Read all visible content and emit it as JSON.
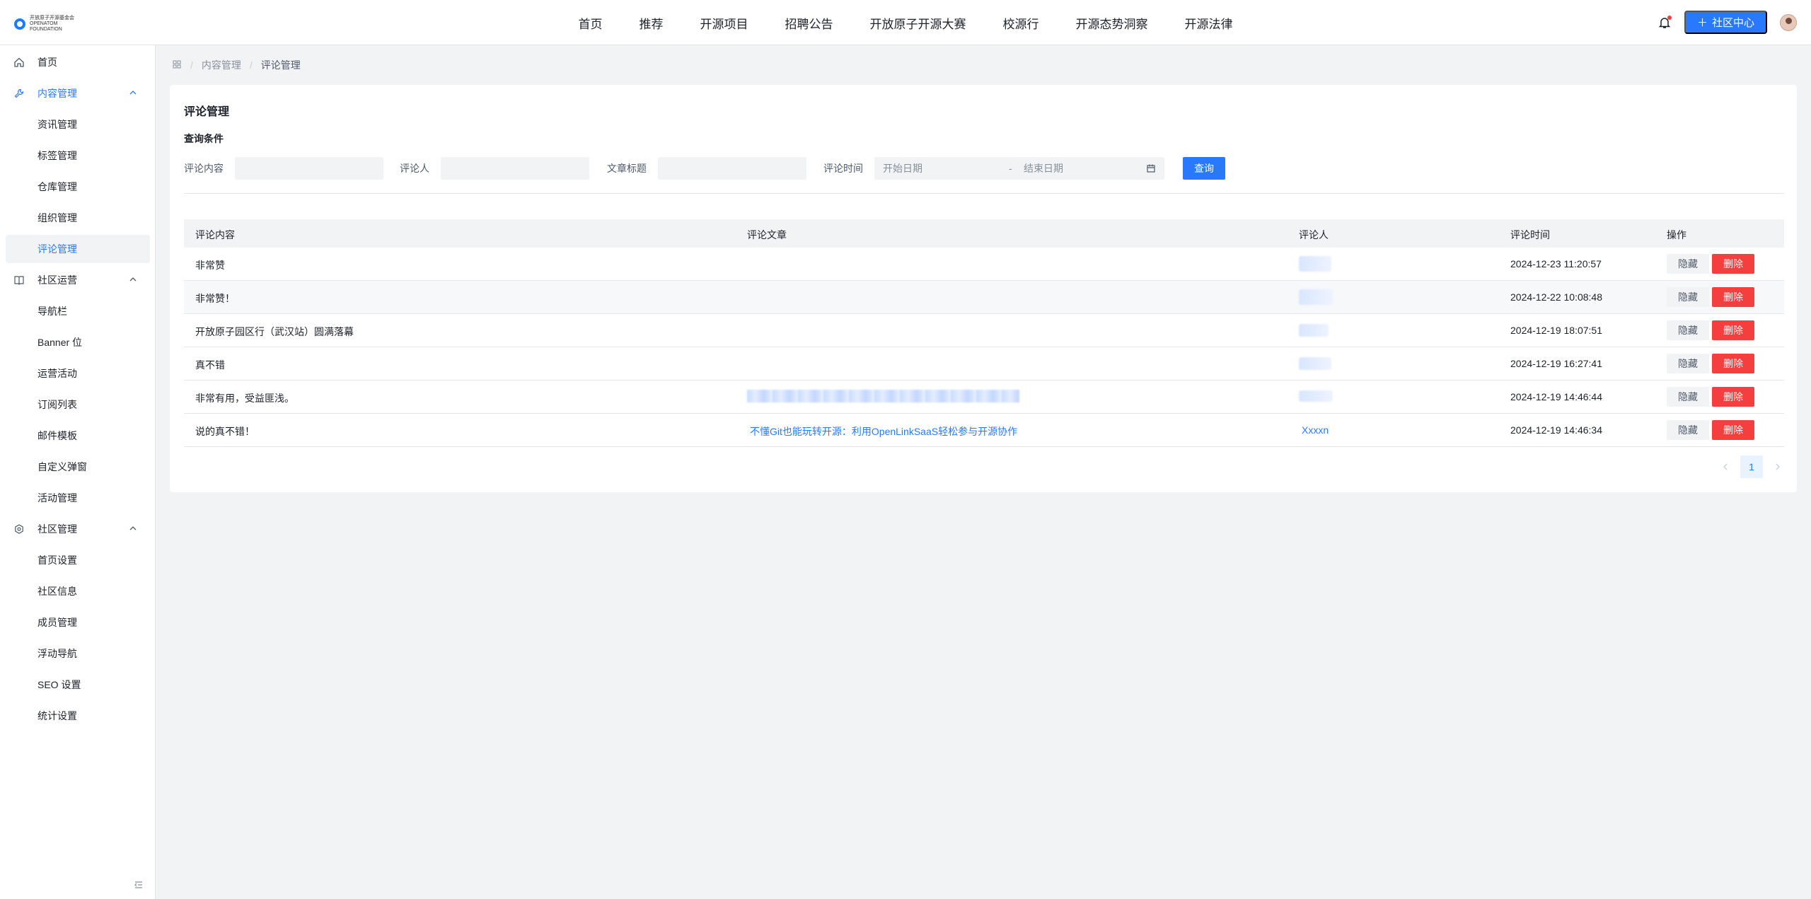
{
  "header": {
    "logo_text": "开放原子开源基金会 OPENATOM FOUNDATION",
    "nav": [
      "首页",
      "推荐",
      "开源项目",
      "招聘公告",
      "开放原子开源大赛",
      "校源行",
      "开源态势洞察",
      "开源法律"
    ],
    "community_button": "社区中心",
    "icons": {
      "notification": "bell-icon",
      "add": "plus-icon"
    }
  },
  "sidebar": {
    "items": [
      {
        "label": "首页",
        "icon": "home-icon"
      },
      {
        "label": "内容管理",
        "icon": "wrench-icon"
      },
      {
        "label": "资讯管理"
      },
      {
        "label": "标签管理"
      },
      {
        "label": "仓库管理"
      },
      {
        "label": "组织管理"
      },
      {
        "label": "评论管理"
      },
      {
        "label": "社区运营",
        "icon": "book-icon"
      },
      {
        "label": "导航栏"
      },
      {
        "label": "Banner 位"
      },
      {
        "label": "运营活动"
      },
      {
        "label": "订阅列表"
      },
      {
        "label": "邮件模板"
      },
      {
        "label": "自定义弹窗"
      },
      {
        "label": "活动管理"
      },
      {
        "label": "社区管理",
        "icon": "settings-icon"
      },
      {
        "label": "首页设置"
      },
      {
        "label": "社区信息"
      },
      {
        "label": "成员管理"
      },
      {
        "label": "浮动导航"
      },
      {
        "label": "SEO 设置"
      },
      {
        "label": "统计设置"
      }
    ]
  },
  "breadcrumb": {
    "level1": "内容管理",
    "level2": "评论管理"
  },
  "card": {
    "title": "评论管理",
    "query_label": "查询条件",
    "filters": {
      "content_label": "评论内容",
      "author_label": "评论人",
      "article_label": "文章标题",
      "time_label": "评论时间",
      "start_placeholder": "开始日期",
      "end_placeholder": "结束日期",
      "dash": "-",
      "query_button": "查询"
    }
  },
  "table": {
    "headers": [
      "评论内容",
      "评论文章",
      "评论人",
      "评论时间",
      "操作"
    ],
    "rows": [
      {
        "content": "非常赞",
        "article": "",
        "author": "",
        "time": "2024-12-23 11:20:57"
      },
      {
        "content": "非常赞！",
        "article": "",
        "author": "",
        "time": "2024-12-22 10:08:48"
      },
      {
        "content": "开放原子园区行（武汉站）圆满落幕",
        "article": "",
        "author": "",
        "time": "2024-12-19 18:07:51"
      },
      {
        "content": "真不错",
        "article": "",
        "author": "",
        "time": "2024-12-19 16:27:41"
      },
      {
        "content": "非常有用，受益匪浅。",
        "article": "",
        "author": "",
        "time": "2024-12-19 14:46:44"
      },
      {
        "content": "说的真不错！",
        "article": "不懂Git也能玩转开源：利用OpenLinkSaaS轻松参与开源协作",
        "author": "Xxxxn",
        "time": "2024-12-19 14:46:34"
      }
    ],
    "hide_label": "隐藏",
    "delete_label": "删除"
  },
  "pagination": {
    "current": "1"
  }
}
